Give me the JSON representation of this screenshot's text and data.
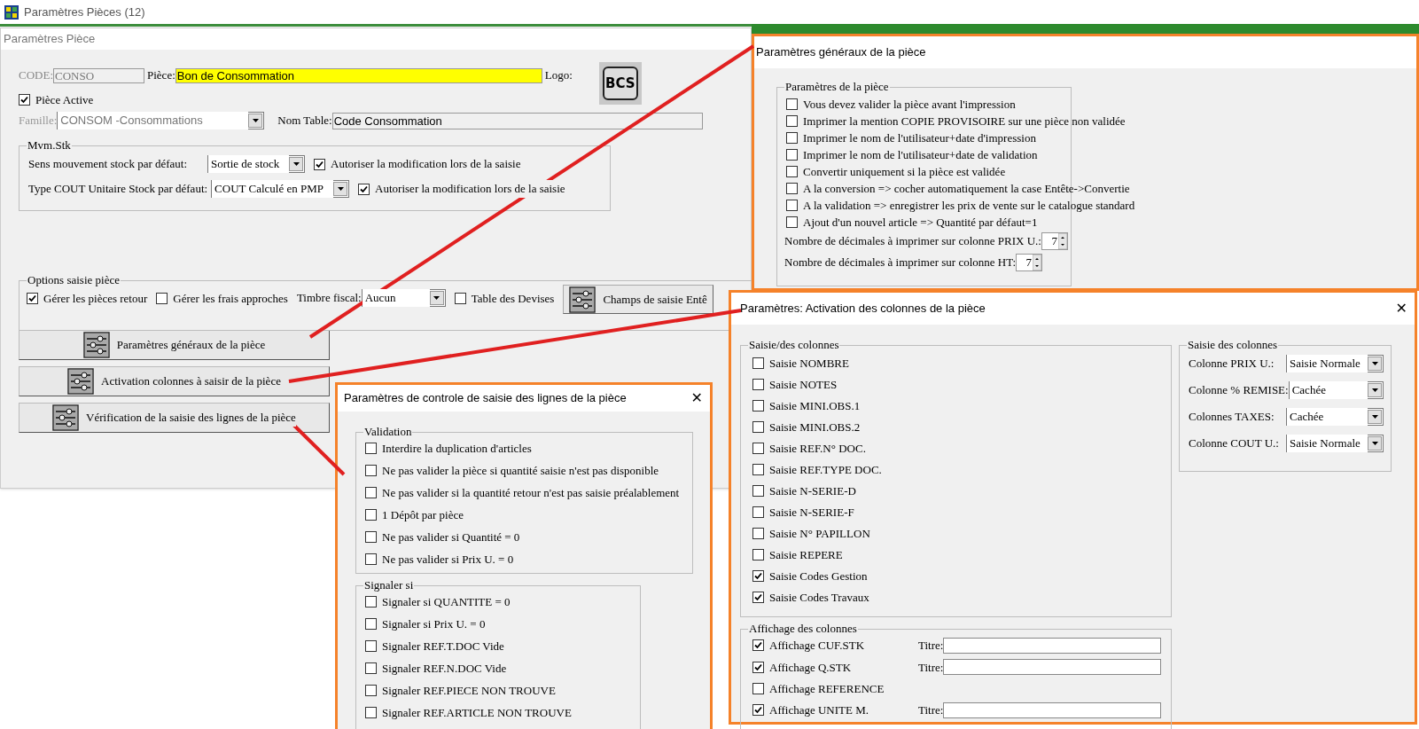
{
  "app_window": {
    "title": "Paramètres Pièces (12)"
  },
  "main_dialog": {
    "title": "Paramètres Pièce",
    "code": {
      "label": "CODE:",
      "value": "CONSO"
    },
    "piece": {
      "label": "Pièce:",
      "value": "Bon de Consommation"
    },
    "logo": {
      "label": "Logo:",
      "text": "BCS"
    },
    "active": {
      "label": "Pièce Active",
      "checked": true
    },
    "famille": {
      "label": "Famille:",
      "value": "CONSOM   -Consommations"
    },
    "nom_table": {
      "label": "Nom Table:",
      "value": "Code Consommation"
    },
    "mvm_stk": {
      "title": "Mvm.Stk",
      "rows": [
        {
          "label": "Sens mouvement stock par défaut:",
          "value": "Sortie de stock",
          "allow": {
            "label": "Autoriser la modification lors de la saisie",
            "checked": true
          }
        },
        {
          "label": "Type COUT Unitaire Stock par défaut:",
          "value": "COUT Calculé en PMP",
          "allow": {
            "label": "Autoriser la modification lors de la saisie",
            "checked": true
          }
        }
      ]
    },
    "options": {
      "title": "Options saisie pièce",
      "retour": {
        "label": "Gérer les pièces retour",
        "checked": true
      },
      "frais": {
        "label": "Gérer les frais approches",
        "checked": false
      },
      "timbre": {
        "label": "Timbre fiscal:",
        "value": "Aucun"
      },
      "devises": {
        "label": "Table des Devises",
        "checked": false
      },
      "champs_button": "Champs de saisie Entê"
    },
    "buttons": [
      "Paramètres généraux de la pièce",
      "Activation colonnes à saisir de la pièce",
      "Vérification  de la saisie des lignes de la pièce"
    ]
  },
  "general_dialog": {
    "title": "Paramètres généraux de la pièce",
    "group": "Paramètres de la pièce",
    "items": [
      {
        "label": "Vous devez valider la pièce avant l'impression",
        "checked": false
      },
      {
        "label": "Imprimer la mention COPIE PROVISOIRE sur une pièce non validée",
        "checked": false
      },
      {
        "label": "Imprimer le nom de l'utilisateur+date d'impression",
        "checked": false
      },
      {
        "label": "Imprimer le nom de l'utilisateur+date de validation",
        "checked": false
      },
      {
        "label": "Convertir uniquement si la pièce est validée",
        "checked": false
      },
      {
        "label": "A la conversion => cocher automatiquement la case Entête->Convertie",
        "checked": false
      },
      {
        "label": "A la validation => enregistrer les prix de vente sur le catalogue standard",
        "checked": false
      },
      {
        "label": "Ajout d'un nouvel article => Quantité par défaut=1",
        "checked": false
      }
    ],
    "spinners": [
      {
        "label": "Nombre de décimales à imprimer sur colonne PRIX U.:",
        "value": "7"
      },
      {
        "label": "Nombre de décimales à imprimer sur colonne HT:",
        "value": "7"
      }
    ]
  },
  "columns_dialog": {
    "title": "Paramètres: Activation des colonnes de la pièce",
    "close": "✕",
    "saisie_group": "Saisie/des colonnes",
    "saisie_items": [
      {
        "label": "Saisie NOMBRE",
        "checked": false
      },
      {
        "label": "Saisie NOTES",
        "checked": false
      },
      {
        "label": "Saisie MINI.OBS.1",
        "checked": false
      },
      {
        "label": "Saisie MINI.OBS.2",
        "checked": false
      },
      {
        "label": "Saisie REF.N° DOC.",
        "checked": false
      },
      {
        "label": "Saisie REF.TYPE DOC.",
        "checked": false
      },
      {
        "label": "Saisie N-SERIE-D",
        "checked": false
      },
      {
        "label": "Saisie N-SERIE-F",
        "checked": false
      },
      {
        "label": "Saisie N° PAPILLON",
        "checked": false
      },
      {
        "label": "Saisie REPERE",
        "checked": false
      },
      {
        "label": "Saisie Codes Gestion",
        "checked": true
      },
      {
        "label": "Saisie Codes Travaux",
        "checked": true
      }
    ],
    "modes_group": "Saisie des colonnes",
    "modes": [
      {
        "label": "Colonne PRIX U.:",
        "value": "Saisie Normale"
      },
      {
        "label": "Colonne % REMISE:",
        "value": "Cachée"
      },
      {
        "label": "Colonnes TAXES:",
        "value": "Cachée"
      },
      {
        "label": "Colonne COUT U.:",
        "value": "Saisie Normale"
      }
    ],
    "display_group": "Affichage des colonnes",
    "display_items": [
      {
        "label": "Affichage CUF.STK",
        "checked": true,
        "title_label": "Titre:"
      },
      {
        "label": "Affichage Q.STK",
        "checked": true,
        "title_label": "Titre:"
      },
      {
        "label": "Affichage REFERENCE",
        "checked": false
      },
      {
        "label": "Affichage UNITE M.",
        "checked": true,
        "title_label": "Titre:"
      }
    ]
  },
  "control_dialog": {
    "title": "Paramètres de controle de saisie des lignes de la pièce",
    "close": "✕",
    "validation_group": "Validation",
    "validation_items": [
      {
        "label": "Interdire la duplication d'articles",
        "checked": false
      },
      {
        "label": "Ne pas valider la pièce si quantité saisie n'est pas disponible",
        "checked": false
      },
      {
        "label": "Ne pas valider si la quantité retour n'est pas saisie préalablement",
        "checked": false
      },
      {
        "label": "1 Dépôt par pièce",
        "checked": false
      },
      {
        "label": "Ne pas valider si Quantité = 0",
        "checked": false
      },
      {
        "label": "Ne pas valider si Prix U. = 0",
        "checked": false
      }
    ],
    "signal_group": "Signaler si",
    "signal_items": [
      {
        "label": "Signaler si QUANTITE = 0",
        "checked": false
      },
      {
        "label": "Signaler si Prix U. = 0",
        "checked": false
      },
      {
        "label": "Signaler REF.T.DOC Vide",
        "checked": false
      },
      {
        "label": "Signaler REF.N.DOC Vide",
        "checked": false
      },
      {
        "label": "Signaler REF.PIECE NON TROUVE",
        "checked": false
      },
      {
        "label": "Signaler REF.ARTICLE NON TROUVE",
        "checked": false
      }
    ]
  }
}
